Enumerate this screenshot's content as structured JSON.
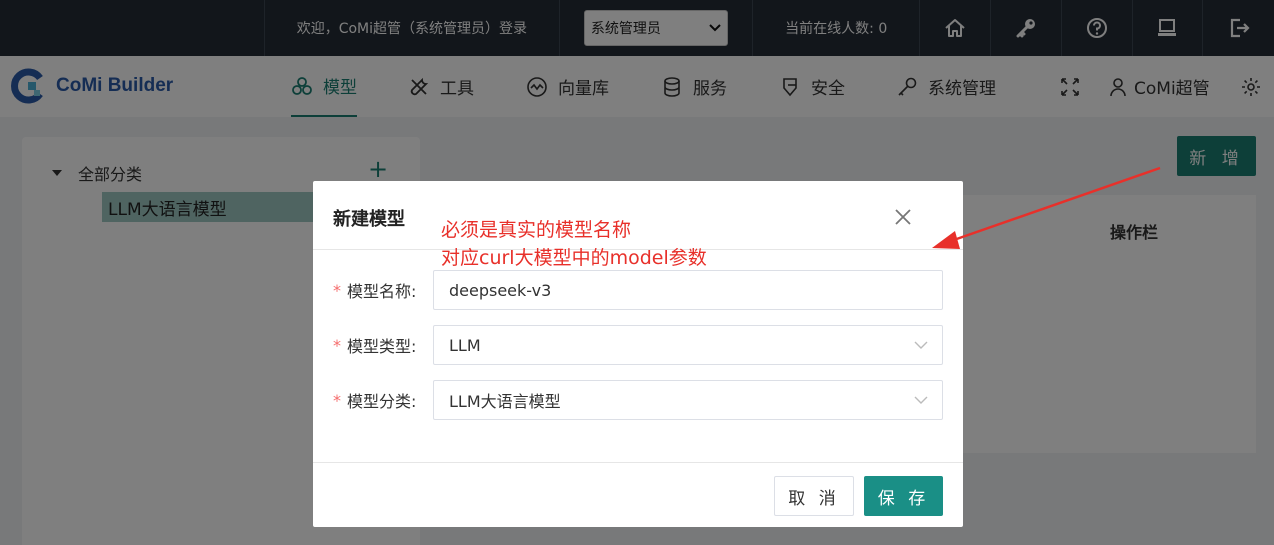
{
  "topbar": {
    "welcome": "欢迎，CoMi超管（系统管理员）登录",
    "role_selected": "系统管理员",
    "online_label": "当前在线人数: 0",
    "icons": [
      "home-icon",
      "key-icon",
      "help-icon",
      "monitor-icon",
      "logout-icon"
    ]
  },
  "navbar": {
    "brand": "CoMi Builder",
    "items": [
      {
        "label": "模型",
        "icon": "model-icon",
        "active": true
      },
      {
        "label": "工具",
        "icon": "tools-icon"
      },
      {
        "label": "向量库",
        "icon": "vector-icon"
      },
      {
        "label": "服务",
        "icon": "database-icon"
      },
      {
        "label": "安全",
        "icon": "shield-icon"
      },
      {
        "label": "系统管理",
        "icon": "key-icon"
      }
    ],
    "user": "CoMi超管"
  },
  "sidebar": {
    "root": "全部分类",
    "child": "LLM大语言模型"
  },
  "main": {
    "add_label": "新 增",
    "action_column": "操作栏"
  },
  "dialog": {
    "title": "新建模型",
    "fields": [
      {
        "label": "模型名称:",
        "value": "deepseek-v3"
      },
      {
        "label": "模型类型:",
        "value": "LLM"
      },
      {
        "label": "模型分类:",
        "value": "LLM大语言模型"
      }
    ],
    "cancel": "取 消",
    "save": "保 存"
  },
  "annotation": {
    "line1": "必须是真实的模型名称",
    "line2": "对应curl大模型中的model参数"
  },
  "colors": {
    "accent": "#1a7f73",
    "topbar": "#242c36",
    "annotation": "#e8302a"
  }
}
